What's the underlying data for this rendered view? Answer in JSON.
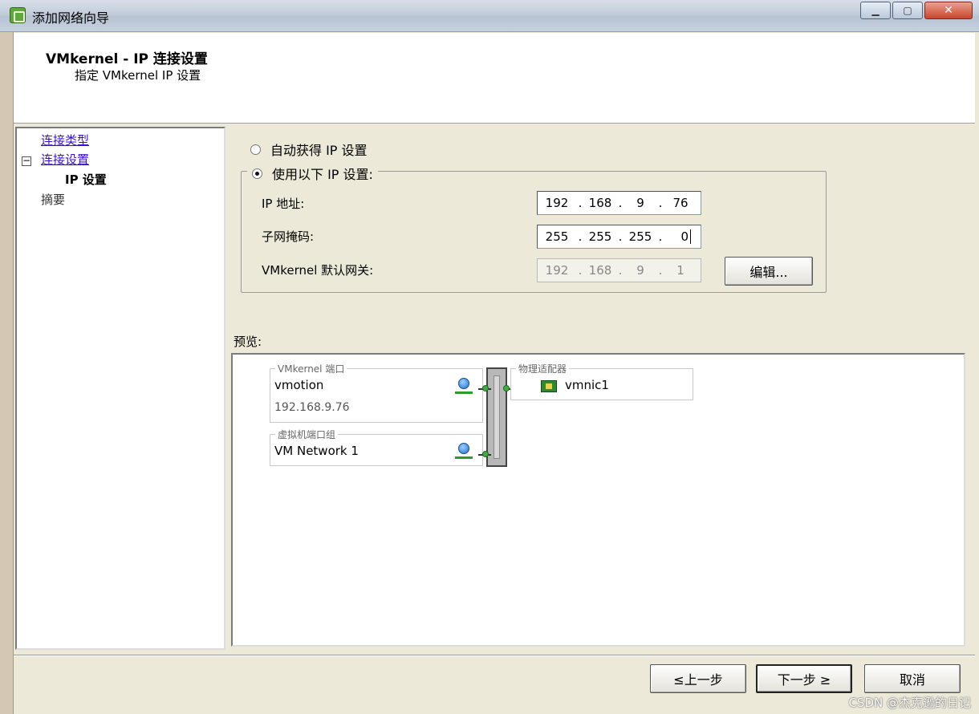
{
  "window": {
    "title": "添加网络向导"
  },
  "header": {
    "title": "VMkernel - IP 连接设置",
    "subtitle": "指定 VMkernel IP 设置"
  },
  "nav": {
    "items": [
      {
        "label": "连接类型",
        "state": "link"
      },
      {
        "label": "连接设置",
        "state": "link",
        "expander": "⊟"
      },
      {
        "label": "IP 设置",
        "state": "current"
      },
      {
        "label": "摘要",
        "state": "disabled"
      }
    ]
  },
  "ip_mode": {
    "auto_label": "自动获得 IP 设置",
    "manual_label": "使用以下 IP 设置:",
    "selected": "manual"
  },
  "fields": {
    "ip_address": {
      "label": "IP 地址:",
      "octets": [
        "192",
        "168",
        "9",
        "76"
      ]
    },
    "subnet_mask": {
      "label": "子网掩码:",
      "octets": [
        "255",
        "255",
        "255",
        "0"
      ]
    },
    "gateway": {
      "label": "VMkernel 默认网关:",
      "octets": [
        "192",
        "168",
        "9",
        "1"
      ],
      "disabled": true
    },
    "edit_button": "编辑..."
  },
  "preview": {
    "label": "预览:",
    "vmkernel_group": {
      "legend": "VMkernel 端口",
      "name": "vmotion",
      "ip": "192.168.9.76"
    },
    "vm_group": {
      "legend": "虚拟机端口组",
      "name": "VM Network 1"
    },
    "adapter_group": {
      "legend": "物理适配器",
      "nic": "vmnic1"
    }
  },
  "footer": {
    "back": "≤上一步",
    "next": "下一步 ≥",
    "cancel": "取消"
  },
  "watermark": "CSDN @杰克逊的日记"
}
